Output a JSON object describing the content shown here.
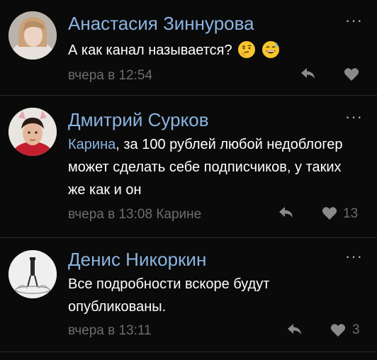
{
  "comments": [
    {
      "author": "Анастасия Зиннурова",
      "text": "А как канал называется?",
      "emojis": [
        "thinking-face-emoji",
        "grinning-sweat-emoji"
      ],
      "time": "вчера в 12:54",
      "likes": ""
    },
    {
      "author": "Дмитрий Сурков",
      "mention": "Карина",
      "text": ", за 100 рублей любой недоблогер может сделать себе подписчиков, у таких же как и он",
      "time": "вчера в 13:08 Карине",
      "likes": "13"
    },
    {
      "author": "Денис Никоркин",
      "text": "Все подробности вскоре будут опубликованы.",
      "time": "вчера в 13:11",
      "likes": "3"
    }
  ],
  "more_label": "···",
  "colors": {
    "background": "#0a0a0a",
    "author": "#8bb4e2",
    "meta": "#6d6d6d",
    "icon": "#8a8a8a",
    "divider": "#2a2a2a"
  }
}
